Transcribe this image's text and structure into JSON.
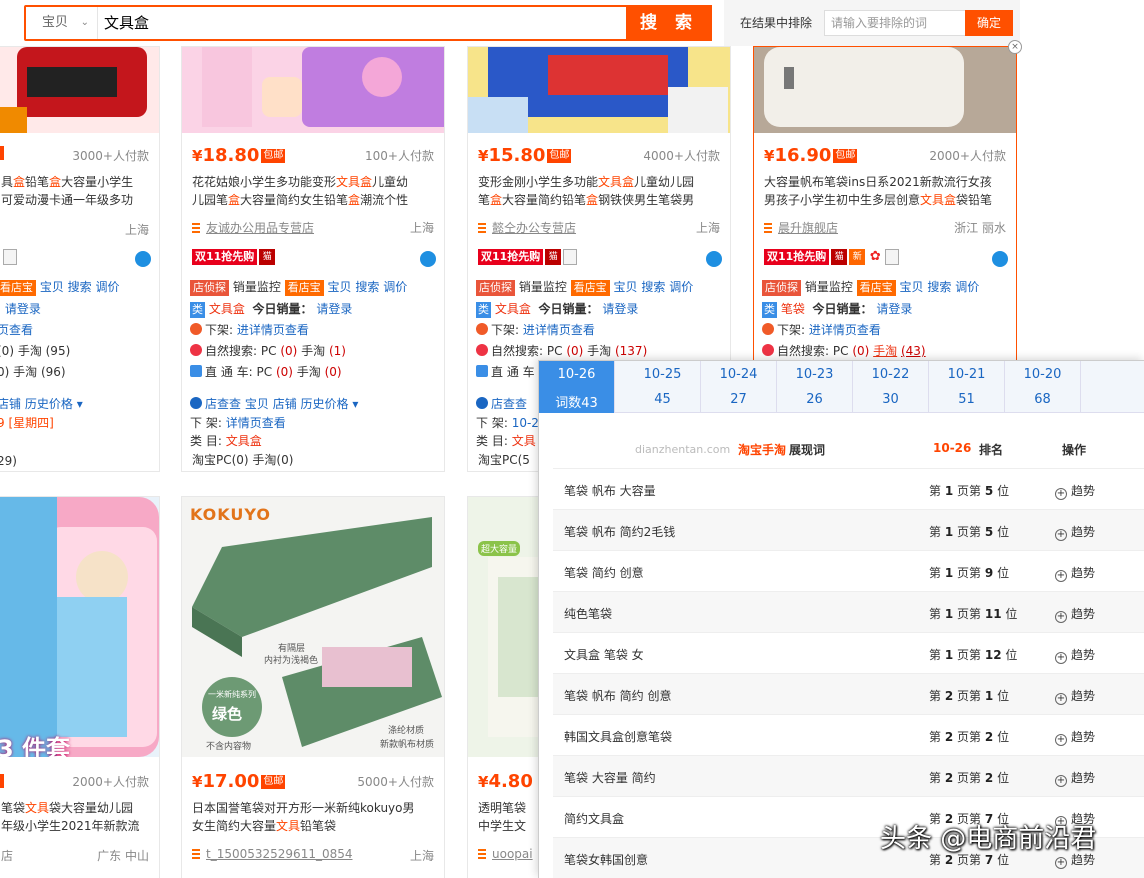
{
  "search": {
    "category": "宝贝",
    "keyword": "文具盒",
    "button": "搜 索"
  },
  "exclude": {
    "label": "在结果中排除",
    "placeholder": "请输入要排除的词",
    "button": "确定"
  },
  "close_glyph": "×",
  "cards_top": [
    {
      "sold": "3000+人付款",
      "title_a": "具",
      "hl1": "盒",
      "title_b": "铅笔",
      "hl2": "盒",
      "title_c": "大容量小学生",
      "line2": "可爱动漫卡通一年级多功",
      "loc": "上海",
      "row1": [
        "看店宝",
        "宝贝",
        "搜索",
        "调价"
      ],
      "row2_p": "页查看",
      "row3": "(0) 手淘 (95)",
      "row4": "0) 手淘 (96)",
      "row5": [
        "店铺",
        "历史价格"
      ],
      "row6": "9 [星期四]",
      "row7": "29)"
    },
    {
      "price": "18.80",
      "sold": "100+人付款",
      "title1": "花花姑娘小学生多功能变形",
      "hl": "文具盒",
      "title1b": "儿童幼",
      "title2a": "儿园笔",
      "hl2": "盒",
      "title2b": "大容量简约女生铅笔",
      "hl3": "盒",
      "title2c": "潮流个性",
      "shop": "友诚办公用品专营店",
      "loc": "上海",
      "tag1": "店侦探",
      "r1a": "销量监控",
      "tag2": "看店宝",
      "r1b": "宝贝",
      "r1c": "搜索",
      "r1d": "调价",
      "tag3": "类",
      "kwd": "文具盒",
      "r2a": "今日销量：",
      "r2b": "请登录",
      "r3a": "下架:",
      "r3b": "进详情页查看",
      "r4a": "自然搜索: PC",
      "r4b": "(0)",
      "r4c": "手淘",
      "r4d": "(1)",
      "r5a": "直 通 车: PC",
      "r5b": "(0)",
      "r5c": "手淘",
      "r5d": "(0)",
      "r6": [
        "店查查",
        "宝贝",
        "店铺",
        "历史价格"
      ],
      "r7a": "下 架:",
      "r7b": "详情页查看",
      "r8a": "类 目:",
      "r8b": "文具盒",
      "r9": "淘宝PC(0) 手淘(0)"
    },
    {
      "price": "15.80",
      "sold": "4000+人付款",
      "title1a": "变形金刚小学生多功能",
      "hl": "文具盒",
      "title1b": "儿童幼儿园",
      "title2a": "笔",
      "hl2": "盒",
      "title2b": "大容量简约铅笔",
      "hl3": "盒",
      "title2c": "钢铁侠男生笔袋男",
      "shop": "懿仝办公专营店",
      "loc": "上海",
      "tag1": "店侦探",
      "r1a": "销量监控",
      "tag2": "看店宝",
      "r1b": "宝贝",
      "r1c": "搜索",
      "r1d": "调价",
      "tag3": "类",
      "kwd": "文具盒",
      "r2a": "今日销量：",
      "r2b": "请登录",
      "r3a": "下架:",
      "r3b": "进详情页查看",
      "r4a": "自然搜索: PC",
      "r4b": "(0)",
      "r4c": "手淘",
      "r4d": "(137)",
      "r5a": "直 通 车",
      "r6a": "店查查",
      "r7a": "下 架:",
      "r7b": "10-2",
      "r8a": "类 目:",
      "r8b": "文具",
      "r9": "淘宝PC(5"
    },
    {
      "price": "16.90",
      "sold": "2000+人付款",
      "title1": "大容量帆布笔袋ins日系2021新款流行女孩",
      "title2a": "男孩子小学生初中生多层创意",
      "hl": "文具盒",
      "title2b": "袋铅笔",
      "shop": "晨升旗舰店",
      "loc": "浙江 丽水",
      "tag1": "店侦探",
      "r1a": "销量监控",
      "tag2": "看店宝",
      "r1b": "宝贝",
      "r1c": "搜索",
      "r1d": "调价",
      "tag3": "类",
      "kwd": "笔袋",
      "r2a": "今日销量：",
      "r2b": "请登录",
      "r3a": "下架:",
      "r3b": "进详情页查看",
      "r4a": "自然搜索: PC",
      "r4b": "(0)",
      "r4c": "手淘",
      "r4d": "(43)"
    }
  ],
  "badge": {
    "double11": "双11抢先购",
    "new": "新"
  },
  "cards_bottom": [
    {
      "img_text": "3 件套",
      "sold": "2000+人付款",
      "t1a": "笔袋",
      "hl": "文具",
      "t1b": "袋大容量幼儿园",
      "t2": "年级小学生2021年新款流",
      "shop": "店",
      "loc": "广东 中山"
    },
    {
      "img_brand": "KOKUYO",
      "img_note1": "有隔层",
      "img_note2": "内衬为浅褐色",
      "img_series": "一米新纯系列",
      "img_color": "绿色",
      "img_excl": "不含内容物",
      "img_note3": "涤纶材质",
      "img_note4": "新款帆布材质",
      "price": "17.00",
      "sold": "5000+人付款",
      "t1": "日本国誉笔袋对开方形一米新纯kokuyo男",
      "t2a": "女生简约大容量",
      "hl": "文具",
      "t2b": "铅笔袋",
      "shop": "t_1500532529611_0854",
      "loc": "上海"
    },
    {
      "img_tag": "超大容量",
      "price": "4.80",
      "t1": "透明笔袋",
      "t2": "中学生文",
      "shop": "uoopai"
    }
  ],
  "panel": {
    "dates": [
      {
        "d": "10-26",
        "c": "词数43"
      },
      {
        "d": "10-25",
        "c": "45"
      },
      {
        "d": "10-24",
        "c": "27"
      },
      {
        "d": "10-23",
        "c": "26"
      },
      {
        "d": "10-22",
        "c": "30"
      },
      {
        "d": "10-21",
        "c": "51"
      },
      {
        "d": "10-20",
        "c": "68"
      }
    ],
    "site": "dianzhentan.com",
    "tb": "淘宝手淘",
    "word": "展现词",
    "date": "10-26",
    "rank": "排名",
    "op": "操作",
    "trend": "趋势",
    "rows": [
      {
        "kw": "笔袋 帆布 大容量",
        "p": "1",
        "w": "5"
      },
      {
        "kw": "笔袋 帆布 简约2毛钱",
        "p": "1",
        "w": "5"
      },
      {
        "kw": "笔袋 简约 创意",
        "p": "1",
        "w": "9"
      },
      {
        "kw": "纯色笔袋",
        "p": "1",
        "w": "11"
      },
      {
        "kw": "文具盒 笔袋 女",
        "p": "1",
        "w": "12"
      },
      {
        "kw": "笔袋 帆布 简约 创意",
        "p": "2",
        "w": "1"
      },
      {
        "kw": "韩国文具盒创意笔袋",
        "p": "2",
        "w": "2"
      },
      {
        "kw": "笔袋 大容量 简约",
        "p": "2",
        "w": "2"
      },
      {
        "kw": "简约文具盒",
        "p": "2",
        "w": "7"
      },
      {
        "kw": "笔袋女韩国创意",
        "p": "2",
        "w": "7"
      }
    ],
    "di": "第",
    "ye": "页",
    "wei": "位"
  },
  "watermark": "头条 @电商前沿君"
}
